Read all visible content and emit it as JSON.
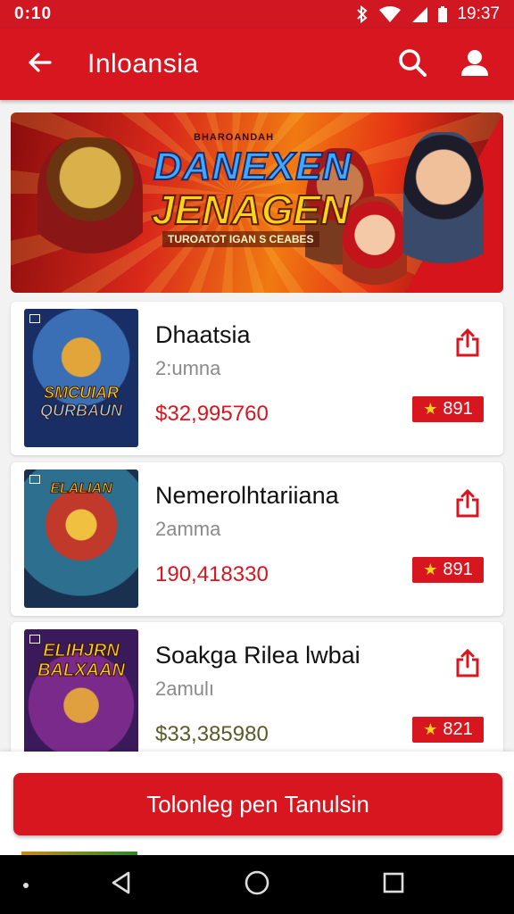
{
  "status_bar": {
    "left_text": "0:10",
    "time": "19:37"
  },
  "app_bar": {
    "title": "Inloansia"
  },
  "banner": {
    "small_text": "BHAROANDAH",
    "line1": "DANEXEN",
    "line2": "JENAGEN",
    "subtitle": "TUROATOT IGAN S CEABES"
  },
  "cards": [
    {
      "title": "Dhaatsia",
      "subtitle": "2:umna",
      "price": "$32,995760",
      "price_color": "#d8161f",
      "rating": "891",
      "thumb_line1": "SMCUIAR",
      "thumb_line2": "QURBAUN"
    },
    {
      "title": "Nemerolhtariiana",
      "subtitle": "2amma",
      "price": "190,418330",
      "price_color": "#d8161f",
      "rating": "891",
      "thumb_line1": "ELALIAN",
      "thumb_line2": ""
    },
    {
      "title": "Soakga Rilea lwbai",
      "subtitle": "2amulı",
      "price": "$33,385980",
      "price_color": "#5a5a2a",
      "rating": "821",
      "thumb_line1": "ELIHJRN",
      "thumb_line2": "BALXAAN"
    }
  ],
  "cta": {
    "label": "Tolonleg pen Tanulsin"
  },
  "colors": {
    "accent": "#d8161f",
    "star": "#ffd21a"
  }
}
